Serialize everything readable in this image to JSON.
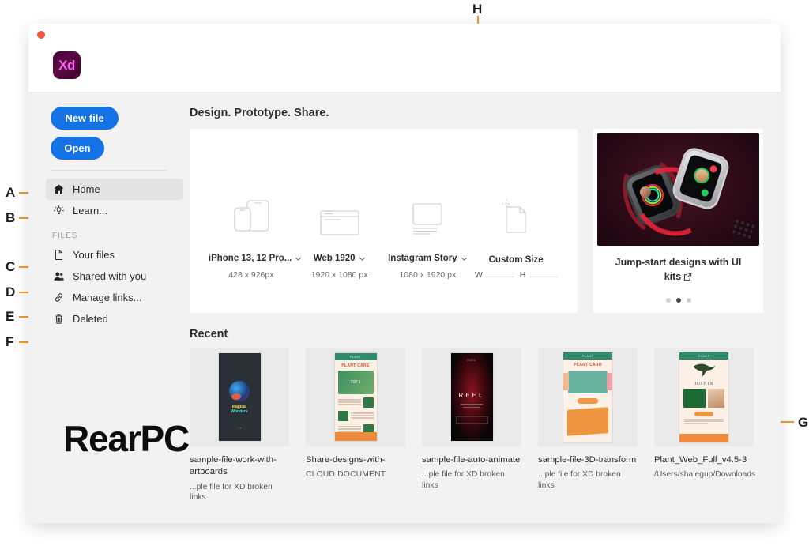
{
  "window": {
    "app_logo_text": "Xd",
    "traffic_dot_color": "#f4553d"
  },
  "sidebar": {
    "new_file_label": "New file",
    "open_label": "Open",
    "section_label": "FILES",
    "items": [
      {
        "label": "Home",
        "icon": "home-icon",
        "active": true
      },
      {
        "label": "Learn...",
        "icon": "lightbulb-icon",
        "active": false
      },
      {
        "label": "Your files",
        "icon": "document-icon",
        "active": false
      },
      {
        "label": "Shared with you",
        "icon": "people-icon",
        "active": false
      },
      {
        "label": "Manage links...",
        "icon": "link-icon",
        "active": false
      },
      {
        "label": "Deleted",
        "icon": "trash-icon",
        "active": false
      }
    ]
  },
  "main": {
    "heading": "Design. Prototype. Share.",
    "recent_heading": "Recent",
    "presets": [
      {
        "name": "iPhone 13, 12 Pro...",
        "size": "428 x 926px",
        "has_chevron": true,
        "art": "phones-icon"
      },
      {
        "name": "Web 1920",
        "size": "1920 x 1080 px",
        "has_chevron": true,
        "art": "browser-icon"
      },
      {
        "name": "Instagram Story",
        "size": "1080 x 1920 px",
        "has_chevron": true,
        "art": "instagram-icon"
      },
      {
        "name": "Custom Size",
        "size": "",
        "has_chevron": false,
        "art": "custom-icon"
      }
    ],
    "custom_fields": {
      "width_label": "W",
      "height_label": "H",
      "width_value": "",
      "height_value": ""
    }
  },
  "promo": {
    "title": "Jump-start designs with UI kits",
    "external_icon": "external-link-icon",
    "dots": [
      false,
      true,
      false
    ]
  },
  "recent_files": [
    {
      "name": "sample-file-work-with-artboards",
      "meta": "...ple file for XD broken links",
      "thumb": "magical-wonders-dark"
    },
    {
      "name": "Share-designs-with-",
      "meta": "CLOUD DOCUMENT",
      "thumb": "plant-care"
    },
    {
      "name": "sample-file-auto-animate",
      "meta": "...ple file for XD broken links",
      "thumb": "reel-dark"
    },
    {
      "name": "sample-file-3D-transform",
      "meta": "...ple file for XD broken links",
      "thumb": "plant-card"
    },
    {
      "name": "Plant_Web_Full_v4.5-3",
      "meta": "/Users/shalegup/Downloads",
      "thumb": "just-in"
    }
  ],
  "watermark": "RearPC",
  "annotations": {
    "color": "#f29b1d",
    "labels": {
      "a": "A",
      "b": "B",
      "c": "C",
      "d": "D",
      "e": "E",
      "f": "F",
      "g": "G",
      "h": "H"
    }
  }
}
